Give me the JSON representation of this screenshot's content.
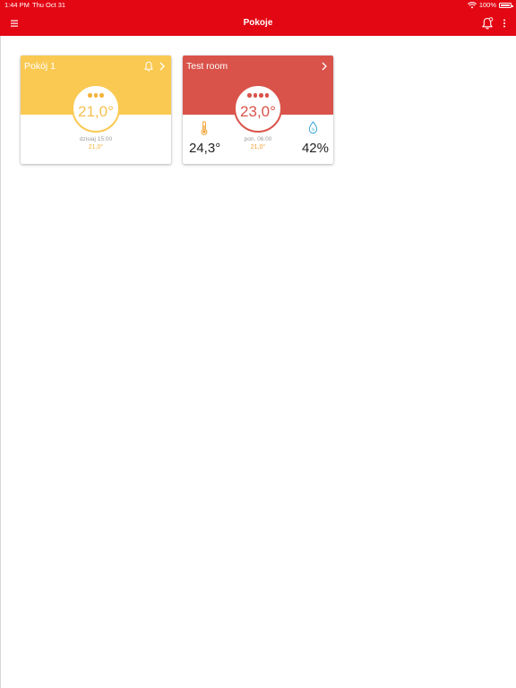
{
  "status_bar": {
    "time": "1:44 PM",
    "date": "Thu Oct 31",
    "battery": "100%"
  },
  "nav": {
    "title": "Pokoje"
  },
  "colors": {
    "brand_red": "#e30613",
    "card1_accent": "#fac952",
    "card2_accent": "#d9534a"
  },
  "rooms": [
    {
      "name": "Pokój 1",
      "set_temp": "21,0°",
      "schedule_time": "dzisiaj 15:00",
      "schedule_temp": "21,0°",
      "mode_dots": 3,
      "has_alert_icon": true
    },
    {
      "name": "Test room",
      "set_temp": "23,0°",
      "schedule_time": "pon. 06:00",
      "schedule_temp": "21,0°",
      "mode_dots": 4,
      "current_temp": "24,3°",
      "humidity": "42%"
    }
  ],
  "icons": [
    "menu-icon",
    "bell-icon",
    "more-icon",
    "chevron-right-icon",
    "thermometer-icon",
    "droplet-icon",
    "wifi-icon",
    "battery-icon"
  ]
}
